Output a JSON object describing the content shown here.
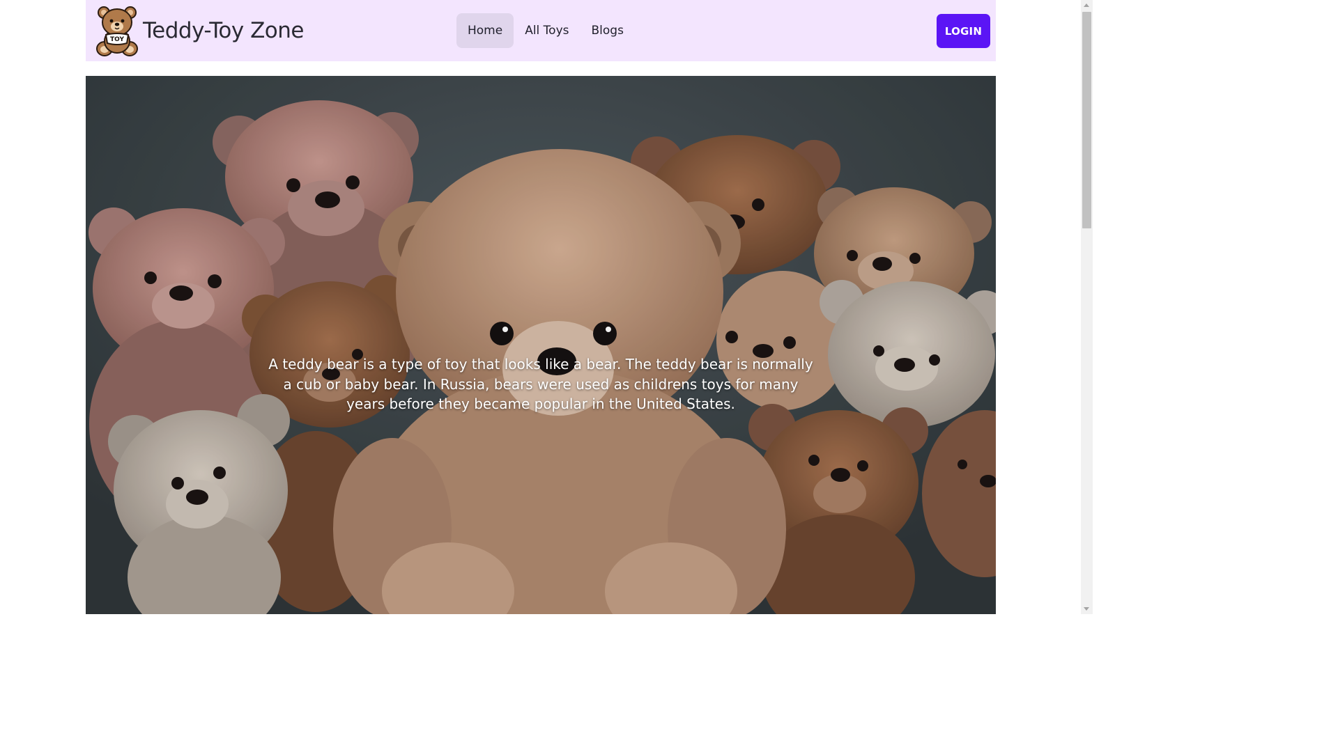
{
  "header": {
    "brand_name": "Teddy-Toy Zone",
    "logo_text": "TOY",
    "nav": [
      {
        "label": "Home",
        "active": true
      },
      {
        "label": "All Toys",
        "active": false
      },
      {
        "label": "Blogs",
        "active": false
      }
    ],
    "login_label": "LOGIN"
  },
  "hero": {
    "text": "A teddy bear is a type of toy that looks like a bear. The teddy bear is normally a cub or baby bear. In Russia, bears were used as childrens toys for many years before they became popular in the United States."
  },
  "colors": {
    "navbar_bg": "#f3e5fe",
    "active_nav_bg": "#e0d5ec",
    "login_bg": "#5b15f5",
    "hero_backdrop": "#3a4246"
  },
  "icons": [
    "teddy-bear-logo-icon",
    "teddy-bears-photo"
  ]
}
